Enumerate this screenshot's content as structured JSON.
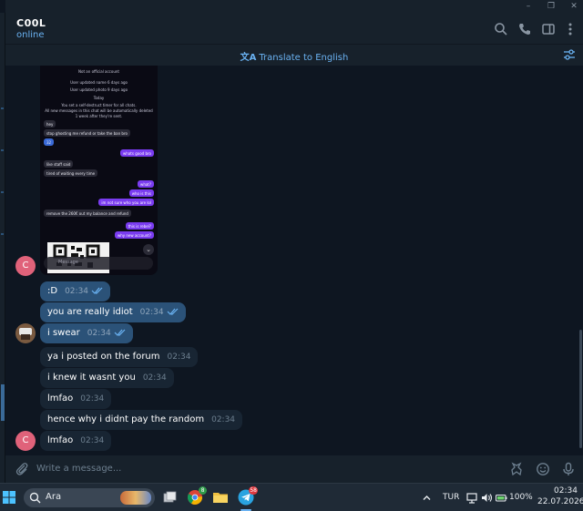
{
  "chat": {
    "name": "C00L",
    "status": "online",
    "translate_label": "Translate to English",
    "translate_glyph": "文A"
  },
  "screenshot": {
    "system_lines": [
      "Not an official account",
      "User updated name 6 days ago",
      "User updated photo 9 days ago",
      "Today",
      "You set a self-destruct timer for all chats.",
      "All new messages in this chat will be automatically deleted",
      "1 week after they're sent."
    ],
    "messages": [
      {
        "side": "in",
        "text": "hey",
        "time": "6:40 AM"
      },
      {
        "side": "in",
        "text": "stop ghosting me refund or take the ban bro",
        "time": "6:40 AM"
      },
      {
        "side": "in",
        "text": "32",
        "time": ""
      },
      {
        "side": "out",
        "text": "whats good bro",
        "time": "6:40 AM"
      },
      {
        "side": "in",
        "text": "like staff said",
        "time": "6:42 AM"
      },
      {
        "side": "in",
        "text": "tired of waiting every time",
        "time": "6:43 AM"
      },
      {
        "side": "out",
        "text": "what?",
        "time": "6:47 AM"
      },
      {
        "side": "out",
        "text": "who is this",
        "time": "6:47 AM"
      },
      {
        "side": "out",
        "text": "im not sure who you are lol",
        "time": "6:47 AM"
      },
      {
        "side": "in",
        "text": "remove the 260€ out my balance and refund",
        "time": "6:50 AM"
      },
      {
        "side": "out",
        "text": "this is rebel?",
        "time": "6:51 AM"
      },
      {
        "side": "out",
        "text": "why new account?",
        "time": "6:51 AM"
      }
    ],
    "input_placeholder": "Message"
  },
  "avatars": {
    "peer_letter": "C"
  },
  "messages": [
    {
      "side": "own",
      "text": ":D",
      "time": "02:34",
      "read": true
    },
    {
      "side": "own",
      "text": "you are really idiot",
      "time": "02:34",
      "read": true
    },
    {
      "side": "own",
      "text": "i swear",
      "time": "02:34",
      "read": true
    },
    {
      "side": "peer",
      "text": "ya i posted on the forum",
      "time": "02:34",
      "read": false
    },
    {
      "side": "peer",
      "text": "i knew it wasnt you",
      "time": "02:34",
      "read": false
    },
    {
      "side": "peer",
      "text": "lmfao",
      "time": "02:34",
      "read": false
    },
    {
      "side": "peer",
      "text": "hence why i didnt pay the random",
      "time": "02:34",
      "read": false
    },
    {
      "side": "peer",
      "text": "lmfao",
      "time": "02:34",
      "read": false
    }
  ],
  "composer": {
    "placeholder": "Write a message..."
  },
  "taskbar": {
    "search_text": "Ara",
    "chrome_badge": "8",
    "telegram_badge": "58",
    "language": "TUR",
    "battery": "100%",
    "time": "02:34",
    "date": "22.07.2026"
  },
  "colors": {
    "accent": "#6ab2f2",
    "own_bubble": "#2b5278",
    "peer_bubble": "#182533",
    "background": "#0e1621",
    "panel": "#17212b"
  }
}
